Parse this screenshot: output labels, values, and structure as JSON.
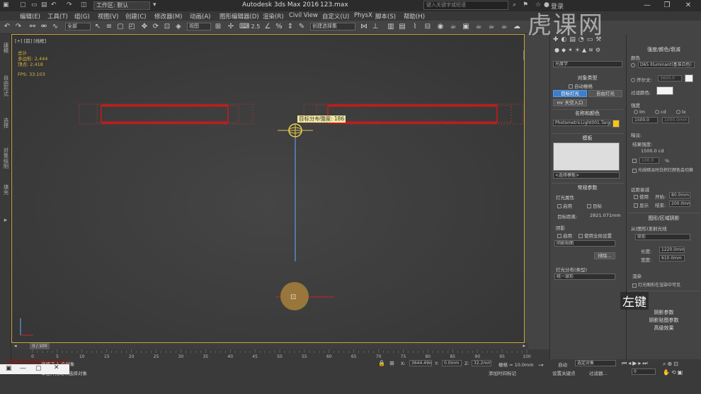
{
  "titlebar": {
    "workspace": "工作区: 默认",
    "app_title": "Autodesk 3ds Max 2016",
    "file_name": "123.max",
    "search_placeholder": "键入关键字或短语",
    "login": "登录"
  },
  "menu": [
    "编辑(E)",
    "工具(T)",
    "组(G)",
    "视图(V)",
    "创建(C)",
    "修改器(M)",
    "动画(A)",
    "图形编辑器(D)",
    "渲染(R)",
    "Civil View",
    "自定义(U)",
    "PhysX",
    "脚本(S)",
    "帮助(H)"
  ],
  "toolbar": {
    "filter": "全部",
    "view": "视图",
    "snap_value": "2.5",
    "selection_set": "创建选择集"
  },
  "left_tabs": [
    "建模",
    "自由形式",
    "选择",
    "对象绘制",
    "填充"
  ],
  "viewport": {
    "label": "[+] [前] [线框]",
    "stats": {
      "total_label": "总计",
      "polys_label": "多边形:",
      "polys": "2,444",
      "verts_label": "顶点:",
      "verts": "2,418",
      "fps_label": "FPS:",
      "fps": "33.103"
    },
    "tooltip": "目标分布强度: 186"
  },
  "command_panel": {
    "category": "光度学",
    "object_type_header": "对象类型",
    "autogrid": "自动栅格",
    "btn_target": "目标灯光",
    "btn_free": "自由灯光",
    "btn_sky": "mr 天空入口",
    "name_color_header": "名称和颜色",
    "object_name": "PhotometricLight001.Target",
    "color": "#f5c518",
    "template_header": "模板",
    "template_select": "<选择模板>",
    "general_header": "常规参数",
    "light_props": "灯光属性",
    "enabled": "启用",
    "targeted": "目标",
    "target_dist_label": "目标距离:",
    "target_dist": "2821.071mm",
    "shadows": "阴影",
    "shadow_on": "启用",
    "use_global": "使用全局设置",
    "shadow_type": "阴影贴图",
    "exclude": "排除...",
    "distribution_label": "灯光分布(类型)",
    "distribution": "统一球形"
  },
  "props_panel": {
    "header": "强度/颜色/衰减",
    "color_label": "颜色",
    "color_preset": "D65 Illuminant(基准白色)",
    "kelvin_label": "开尔文:",
    "kelvin": "3600.0",
    "filter_label": "过滤颜色:",
    "intensity_label": "强度",
    "lm": "lm",
    "cd": "cd",
    "lx": "lx",
    "intensity": "1500.0",
    "intensity2": "1000.0mm",
    "dimming_label": "暗淡:",
    "result_label": "结果强度:",
    "result": "1500.0 cd",
    "percent": "100.0",
    "percent_unit": "%",
    "dim_note": "光线暗淡时白炽灯颜色会切换",
    "far_atten": "远距衰减",
    "use": "使用",
    "start_label": "开始:",
    "start": "80.0mm",
    "show": "显示",
    "end_label": "结束:",
    "end": "200.0mm",
    "shape_header": "图形/区域阴影",
    "emit_label": "从(图形)发射光线",
    "emit_shape": "矩形",
    "length_label": "长度:",
    "length": "1220.0mm",
    "width_label": "宽度:",
    "width": "610.0mm",
    "render_label": "渲染",
    "render_cb": "灯光图形在渲染中可见",
    "rollout1": "阴影参数",
    "rollout2": "阴影贴图参数",
    "rollout3": "高级效果"
  },
  "timeline": {
    "frame": "0 / 100",
    "ticks": [
      "0",
      "5",
      "10",
      "15",
      "20",
      "25",
      "30",
      "35",
      "40",
      "45",
      "50",
      "55",
      "60",
      "65",
      "70",
      "75",
      "80",
      "85",
      "90",
      "95",
      "100"
    ]
  },
  "status": {
    "selected": "选择了 1 个对象",
    "hint": "单击并拖动以选择对象",
    "x": "3644.49m",
    "y": "0.0mm",
    "z": "32.2mm",
    "grid": "栅格 = 10.0mm",
    "add_time_tag": "添加时间标记",
    "auto": "自动",
    "set_key": "设置关键点",
    "key_mode": "选定对象",
    "key_filters": "过滤器...",
    "frame_field": "0"
  },
  "watermark": "虎课网",
  "key_overlay": "左键"
}
